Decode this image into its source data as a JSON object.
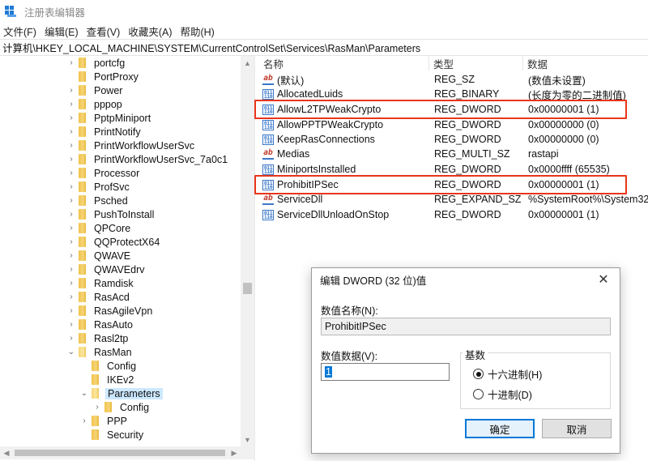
{
  "window": {
    "title": "注册表编辑器"
  },
  "menu": [
    "文件(F)",
    "编辑(E)",
    "查看(V)",
    "收藏夹(A)",
    "帮助(H)"
  ],
  "address": "计算机\\HKEY_LOCAL_MACHINE\\SYSTEM\\CurrentControlSet\\Services\\RasMan\\Parameters",
  "tree": {
    "items": [
      {
        "label": "portcfg"
      },
      {
        "label": "PortProxy"
      },
      {
        "label": "Power"
      },
      {
        "label": "pppop"
      },
      {
        "label": "PptpMiniport"
      },
      {
        "label": "PrintNotify"
      },
      {
        "label": "PrintWorkflowUserSvc"
      },
      {
        "label": "PrintWorkflowUserSvc_7a0c1"
      },
      {
        "label": "Processor"
      },
      {
        "label": "ProfSvc"
      },
      {
        "label": "Psched"
      },
      {
        "label": "PushToInstall"
      },
      {
        "label": "QPCore"
      },
      {
        "label": "QQProtectX64"
      },
      {
        "label": "QWAVE"
      },
      {
        "label": "QWAVEdrv"
      },
      {
        "label": "Ramdisk"
      },
      {
        "label": "RasAcd"
      },
      {
        "label": "RasAgileVpn"
      },
      {
        "label": "RasAuto"
      },
      {
        "label": "Rasl2tp"
      },
      {
        "label": "RasMan"
      },
      {
        "label": "Config"
      },
      {
        "label": "IKEv2"
      },
      {
        "label": "Parameters"
      },
      {
        "label": "Config"
      },
      {
        "label": "PPP"
      },
      {
        "label": "Security"
      }
    ]
  },
  "list": {
    "headers": {
      "name": "名称",
      "type": "类型",
      "data": "数据"
    },
    "rows": [
      {
        "icon": "string-value-icon",
        "name": "(默认)",
        "type": "REG_SZ",
        "data": "(数值未设置)"
      },
      {
        "icon": "binary-value-icon",
        "name": "AllocatedLuids",
        "type": "REG_BINARY",
        "data": "(长度为零的二进制值)"
      },
      {
        "icon": "binary-value-icon",
        "name": "AllowL2TPWeakCrypto",
        "type": "REG_DWORD",
        "data": "0x00000001 (1)"
      },
      {
        "icon": "binary-value-icon",
        "name": "AllowPPTPWeakCrypto",
        "type": "REG_DWORD",
        "data": "0x00000000 (0)"
      },
      {
        "icon": "binary-value-icon",
        "name": "KeepRasConnections",
        "type": "REG_DWORD",
        "data": "0x00000000 (0)"
      },
      {
        "icon": "string-value-icon",
        "name": "Medias",
        "type": "REG_MULTI_SZ",
        "data": "rastapi"
      },
      {
        "icon": "binary-value-icon",
        "name": "MiniportsInstalled",
        "type": "REG_DWORD",
        "data": "0x0000ffff (65535)"
      },
      {
        "icon": "binary-value-icon",
        "name": "ProhibitIPSec",
        "type": "REG_DWORD",
        "data": "0x00000001 (1)"
      },
      {
        "icon": "string-value-icon",
        "name": "ServiceDll",
        "type": "REG_EXPAND_SZ",
        "data": "%SystemRoot%\\System32"
      },
      {
        "icon": "binary-value-icon",
        "name": "ServiceDllUnloadOnStop",
        "type": "REG_DWORD",
        "data": "0x00000001 (1)"
      }
    ]
  },
  "dialog": {
    "title": "编辑 DWORD (32 位)值",
    "name_label": "数值名称(N):",
    "name_value": "ProhibitIPSec",
    "data_label": "数值数据(V):",
    "data_value": "1",
    "base_label": "基数",
    "hex_label": "十六进制(H)",
    "dec_label": "十进制(D)",
    "ok": "确定",
    "cancel": "取消"
  },
  "colors": {
    "highlight": "#e8351a",
    "selection": "#cce8ff",
    "accent": "#0078d7"
  }
}
